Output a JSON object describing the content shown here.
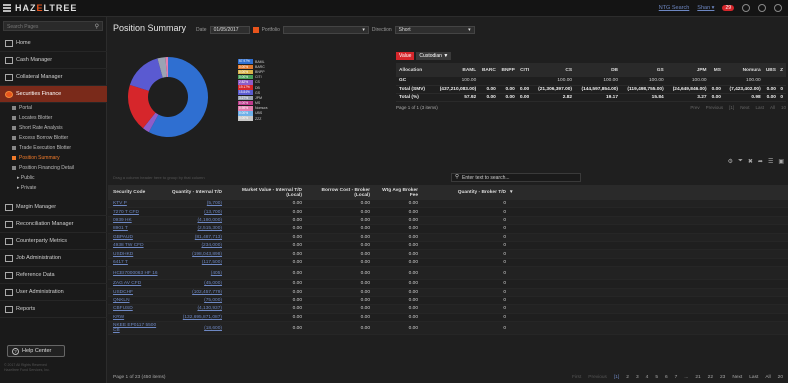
{
  "app": {
    "brand_prefix": "HAZ",
    "brand_mid": "E",
    "brand_suffix": "LTREE",
    "top_link": "NTG Search",
    "user_link": "Shan ▾",
    "notif_count": "29"
  },
  "sidebar": {
    "search_placeholder": "Search Pages",
    "items": [
      {
        "label": "Home"
      },
      {
        "label": "Cash Manager"
      },
      {
        "label": "Collateral Manager"
      },
      {
        "label": "Securities Finance"
      }
    ],
    "subitems": [
      "Portal",
      "Locates Blotter",
      "Short Rate Analysis",
      "Excess Borrow Blotter",
      "Trade Execution Blotter",
      "Position Summary",
      "Position Financing Detail"
    ],
    "folders": [
      "Public",
      "Private"
    ],
    "items2": [
      {
        "label": "Margin Manager"
      },
      {
        "label": "Reconciliation Manager"
      },
      {
        "label": "Counterparty Metrics"
      },
      {
        "label": "Job Administration"
      },
      {
        "label": "Reference Data"
      },
      {
        "label": "User Administration"
      },
      {
        "label": "Reports"
      }
    ],
    "help": "Help Center",
    "foot1": "© 2017 All Rights Reserved",
    "foot2": "Hazeltree Fund Services, Inc."
  },
  "header": {
    "title": "Position Summary",
    "date_label": "Date",
    "date_value": "01/05/2017",
    "portfolio_label": "Portfolio",
    "direction_label": "Direction",
    "direction_value": "Short"
  },
  "donut": {
    "legend": [
      {
        "pct": "57.97%",
        "name": "BAML",
        "color": "#2f6fd1"
      },
      {
        "pct": "0.00%",
        "name": "BARC",
        "color": "#e07a30"
      },
      {
        "pct": "0.00%",
        "name": "BNPP",
        "color": "#d9b44a"
      },
      {
        "pct": "0.00%",
        "name": "CITI",
        "color": "#4aa15a"
      },
      {
        "pct": "2.82%",
        "name": "CS",
        "color": "#8e5dc9"
      },
      {
        "pct": "19.17%",
        "name": "DB",
        "color": "#d6262b"
      },
      {
        "pct": "15.84%",
        "name": "GS",
        "color": "#5a5ad1"
      },
      {
        "pct": "3.27%",
        "name": "JPM",
        "color": "#9aa3b3"
      },
      {
        "pct": "0.00%",
        "name": "MS",
        "color": "#bd3a8b"
      },
      {
        "pct": "0.98%",
        "name": "Nomura",
        "color": "#e37fb0"
      },
      {
        "pct": "0.00%",
        "name": "UBS",
        "color": "#6fb0e8"
      },
      {
        "pct": "0.00%",
        "name": "ZZZ",
        "color": "#c9c9c9"
      }
    ]
  },
  "allocation": {
    "tag_value": "Value",
    "tag_custodian": "Custodian",
    "columns": [
      "Allocation",
      "BAML",
      "BARC",
      "BNPP",
      "CITI",
      "CS",
      "DB",
      "GS",
      "JPM",
      "MS",
      "Nomura",
      "UBS",
      "Z"
    ],
    "rows": [
      {
        "label": "GC",
        "cells": [
          "100.00",
          "",
          "",
          "",
          "100.00",
          "100.00",
          "100.00",
          "100.00",
          "",
          "100.00",
          "",
          ""
        ]
      },
      {
        "label": "Total (SMV)",
        "cells": [
          "(437,210,083.00)",
          "0.00",
          "0.00",
          "0.00",
          "(21,306,397.00)",
          "(144,597,854.00)",
          "(119,498,755.00)",
          "(24,649,846.00)",
          "0.00",
          "(7,423,402.00)",
          "0.00",
          "0"
        ]
      },
      {
        "label": "Total (%)",
        "cells": [
          "57.92",
          "0.00",
          "0.00",
          "0.00",
          "2.82",
          "19.17",
          "15.84",
          "3.27",
          "0.00",
          "0.98",
          "0.00",
          "0"
        ]
      }
    ],
    "page_text": "Page 1 of 1 (3 items)",
    "pager": [
      "Prev",
      "Previous",
      "[1]",
      "Next",
      "Last",
      "All",
      "10"
    ]
  },
  "grid": {
    "group_hint": "Drag a column header here to group by that column",
    "quick_filter": "Enter text to search...",
    "columns": [
      "Security Code",
      "Quantity - Internal T/D",
      "Market Value - Internal T/D (Local)",
      "Borrow Cost - Broker (Local)",
      "Wtg Avg Broker Fee",
      "Quantity - Broker T/D"
    ],
    "rows": [
      [
        "KTV P",
        "(5,700)",
        "0.00",
        "0.00",
        "0.00",
        "0"
      ],
      [
        "7270 T CFD",
        "(13,700)",
        "0.00",
        "0.00",
        "0.00",
        "0"
      ],
      [
        "0939 HK",
        "(4,180,000)",
        "0.00",
        "0.00",
        "0.00",
        "0"
      ],
      [
        "8901 T",
        "(2,515,300)",
        "0.00",
        "0.00",
        "0.00",
        "0"
      ],
      [
        "GBPAUD",
        "(81,487,713)",
        "0.00",
        "0.00",
        "0.00",
        "0"
      ],
      [
        "4938 TW CFD",
        "(234,000)",
        "0.00",
        "0.00",
        "0.00",
        "0"
      ],
      [
        "USDHKD",
        "(198,043,898)",
        "0.00",
        "0.00",
        "0.00",
        "0"
      ],
      [
        "6417 T",
        "(117,500)",
        "0.00",
        "0.00",
        "0.00",
        "0"
      ],
      [
        "HCEI7000063 HF 16",
        "(405)",
        "0.00",
        "0.00",
        "0.00",
        "0"
      ],
      [
        "ZAG AV CFD",
        "(45,000)",
        "0.00",
        "0.00",
        "0.00",
        "0"
      ],
      [
        "USDCHF",
        "(102,457,779)",
        "0.00",
        "0.00",
        "0.00",
        "0"
      ],
      [
        "QNKLN",
        "(75,000)",
        "0.00",
        "0.00",
        "0.00",
        "0"
      ],
      [
        "CBFUSD",
        "(4,130,937)",
        "0.00",
        "0.00",
        "0.00",
        "0"
      ],
      [
        "KRW",
        "(132,695,871,087)",
        "0.00",
        "0.00",
        "0.00",
        "0"
      ],
      [
        "NKEE EP0117 5500 CB",
        "(18,600)",
        "0.00",
        "0.00",
        "0.00",
        "0"
      ]
    ],
    "page_text": "Page 1 of 23 (450 items)",
    "pages": [
      "First",
      "Previous",
      "[1]",
      "2",
      "3",
      "4",
      "5",
      "6",
      "7",
      "...",
      "21",
      "22",
      "23",
      "Next",
      "Last",
      "All",
      "20"
    ]
  }
}
